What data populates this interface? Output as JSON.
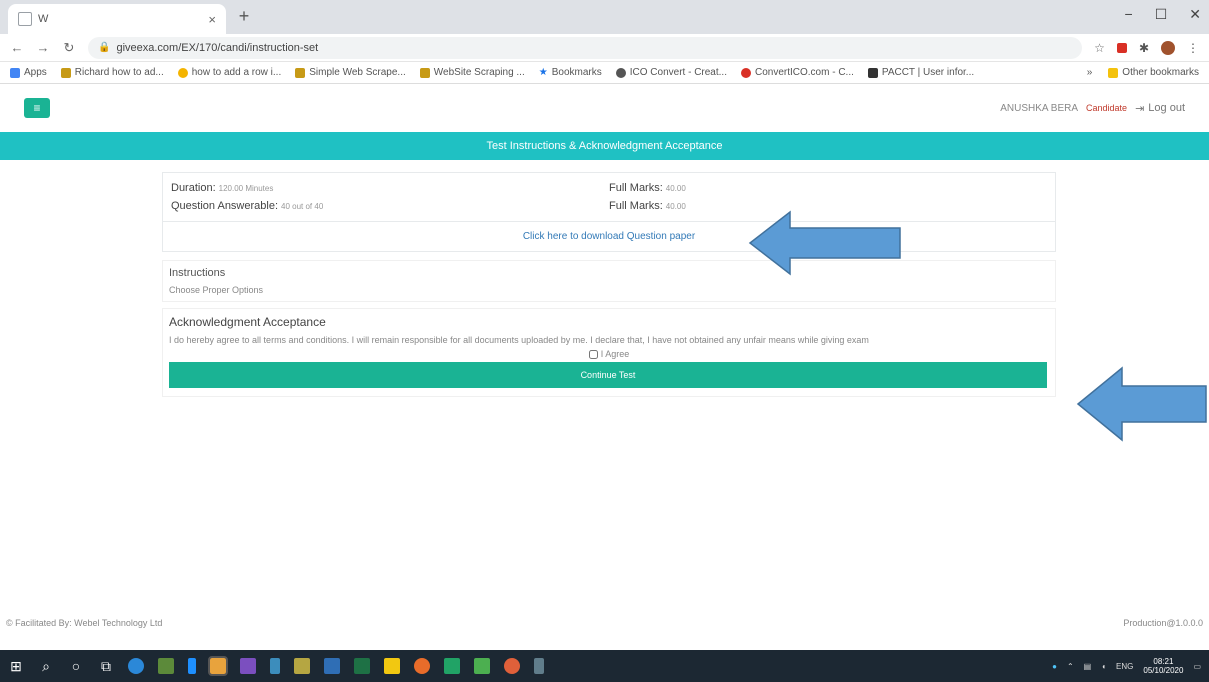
{
  "browser": {
    "tab_title": "W",
    "tab_close": "×",
    "new_tab": "+",
    "window_minimize": "−",
    "window_maximize": "☐",
    "window_close": "✕",
    "url": "giveexa.com/EX/170/candi/instruction-set",
    "bookmarks": [
      {
        "label": "Apps",
        "color": "#4285f4"
      },
      {
        "label": "Richard how to ad...",
        "color": "#c79a16"
      },
      {
        "label": "how to add a row i...",
        "color": "#f4b400"
      },
      {
        "label": "Simple Web Scrape...",
        "color": "#c79a16"
      },
      {
        "label": "WebSite Scraping ...",
        "color": "#c79a16"
      },
      {
        "label": "Bookmarks",
        "color": "#1a73e8"
      },
      {
        "label": "ICO Convert - Creat...",
        "color": "#555555"
      },
      {
        "label": "ConvertICO.com - C...",
        "color": "#d93025"
      },
      {
        "label": "PACCT | User infor...",
        "color": "#333333"
      }
    ],
    "other_bookmarks": "Other bookmarks"
  },
  "header": {
    "menu_icon": "≡",
    "user_name": "ANUSHKA BERA",
    "user_role": "Candidate",
    "logout_label": "Log out"
  },
  "banner": {
    "title": "Test Instructions & Acknowledgment Acceptance"
  },
  "test_info": {
    "duration_label": "Duration:",
    "duration_value": "120.00 Minutes",
    "full_marks_label_1": "Full Marks:",
    "full_marks_value_1": "40.00",
    "questions_label": "Question Answerable:",
    "questions_value": "40 out of 40",
    "full_marks_label_2": "Full Marks:",
    "full_marks_value_2": "40.00",
    "download_link": "Click here to download Question paper"
  },
  "instructions": {
    "title": "Instructions",
    "text": "Choose Proper Options"
  },
  "acknowledgment": {
    "title": "Acknowledgment Acceptance",
    "text": "I do hereby agree to all terms and conditions. I will remain responsible for all documents uploaded by me. I declare that, I have not obtained any unfair means while giving exam",
    "agree_label": "I Agree",
    "continue_label": "Continue Test"
  },
  "footer": {
    "left": "© Facilitated By: Webel Technology Ltd",
    "right": "Production@1.0.0.0"
  },
  "taskbar": {
    "clock_time": "08:21",
    "clock_date": "05/10/2020",
    "lang": "ENG"
  }
}
